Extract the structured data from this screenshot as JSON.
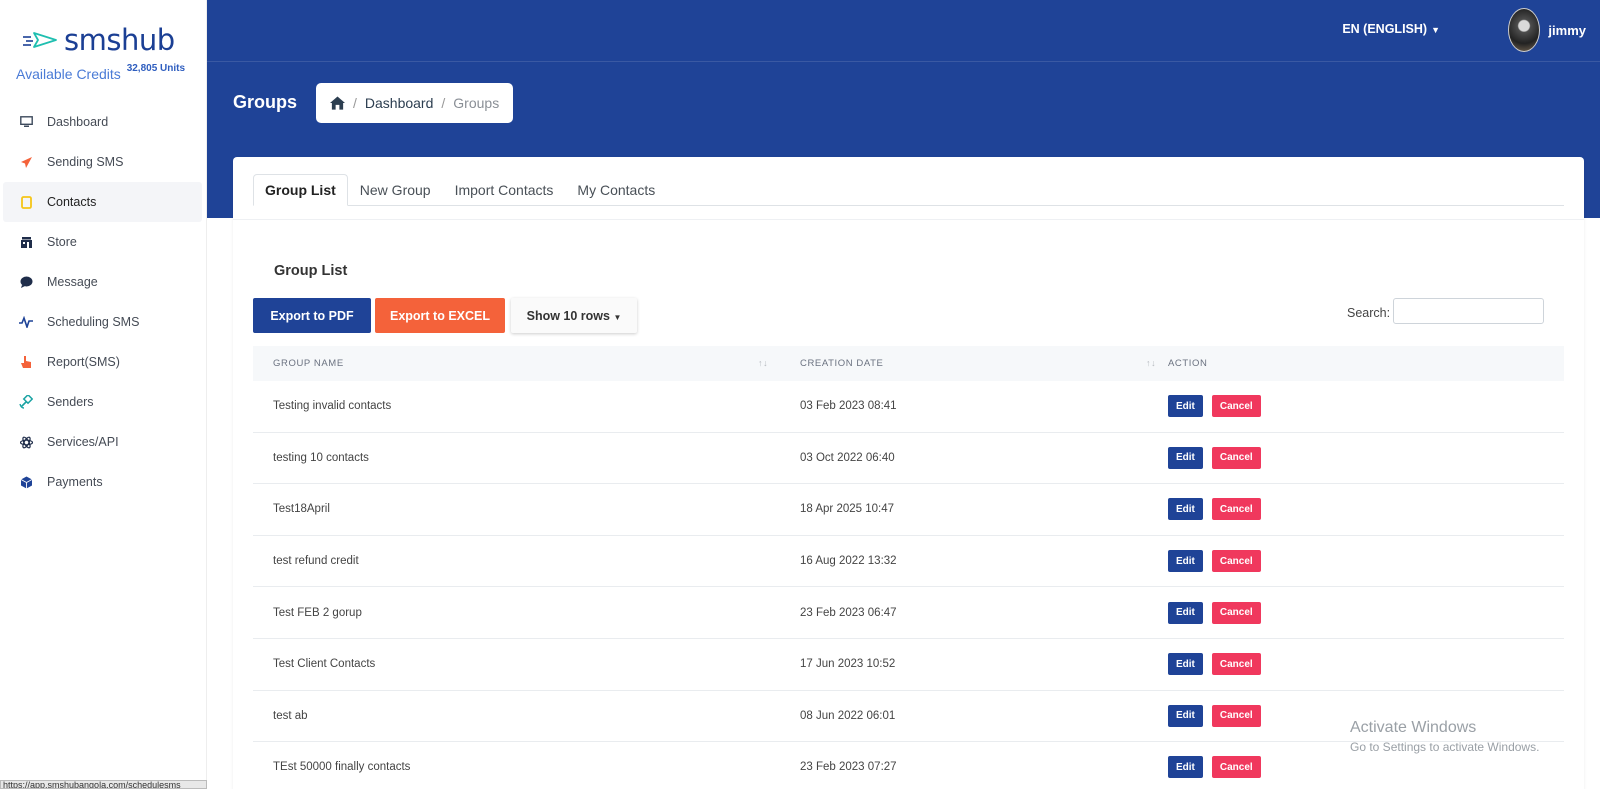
{
  "app": {
    "logo_text": "smshub",
    "credits_label": "Available Credits",
    "credits_value": "32,805 Units"
  },
  "sidebar": {
    "items": [
      {
        "label": "Dashboard",
        "icon": "monitor-icon",
        "color": "#3d4a5c"
      },
      {
        "label": "Sending SMS",
        "icon": "paper-plane-icon",
        "color": "#f4623a"
      },
      {
        "label": "Contacts",
        "icon": "tablet-icon",
        "color": "#f5c518"
      },
      {
        "label": "Store",
        "icon": "store-icon",
        "color": "#1f2d4a"
      },
      {
        "label": "Message",
        "icon": "chat-bubble-icon",
        "color": "#1f2d4a"
      },
      {
        "label": "Scheduling SMS",
        "icon": "pulse-icon",
        "color": "#1f4397"
      },
      {
        "label": "Report(SMS)",
        "icon": "hand-pointer-icon",
        "color": "#f4623a"
      },
      {
        "label": "Senders",
        "icon": "satellite-icon",
        "color": "#1aa3a3"
      },
      {
        "label": "Services/API",
        "icon": "atom-icon",
        "color": "#1f2d4a"
      },
      {
        "label": "Payments",
        "icon": "cube-icon",
        "color": "#1f4397"
      }
    ]
  },
  "header": {
    "language": "EN (ENGLISH)",
    "username": "jimmy"
  },
  "page": {
    "title": "Groups",
    "breadcrumb_dashboard": "Dashboard",
    "breadcrumb_current": "Groups"
  },
  "tabs": [
    "Group List",
    "New Group",
    "Import Contacts",
    "My Contacts"
  ],
  "list": {
    "title": "Group List",
    "export_pdf": "Export to PDF",
    "export_excel": "Export to EXCEL",
    "show_rows": "Show 10 rows",
    "search_label": "Search:"
  },
  "table": {
    "headers": [
      "GROUP NAME",
      "CREATION DATE",
      "ACTION"
    ],
    "edit_label": "Edit",
    "cancel_label": "Cancel",
    "rows": [
      {
        "name": "Testing invalid contacts",
        "date": "03 Feb 2023 08:41"
      },
      {
        "name": "testing 10 contacts",
        "date": "03 Oct 2022 06:40"
      },
      {
        "name": "Test18April",
        "date": "18 Apr 2025 10:47"
      },
      {
        "name": "test refund credit",
        "date": "16 Aug 2022 13:32"
      },
      {
        "name": "Test FEB 2 gorup",
        "date": "23 Feb 2023 06:47"
      },
      {
        "name": "Test Client Contacts",
        "date": "17 Jun 2023 10:52"
      },
      {
        "name": "test ab",
        "date": "08 Jun 2022 06:01"
      },
      {
        "name": "TEst 50000 finally contacts",
        "date": "23 Feb 2023 07:27"
      }
    ]
  },
  "watermark": {
    "line1": "Activate Windows",
    "line2": "Go to Settings to activate Windows."
  },
  "statusbar": {
    "url": "https://app.smshubangola.com/schedulesms"
  }
}
